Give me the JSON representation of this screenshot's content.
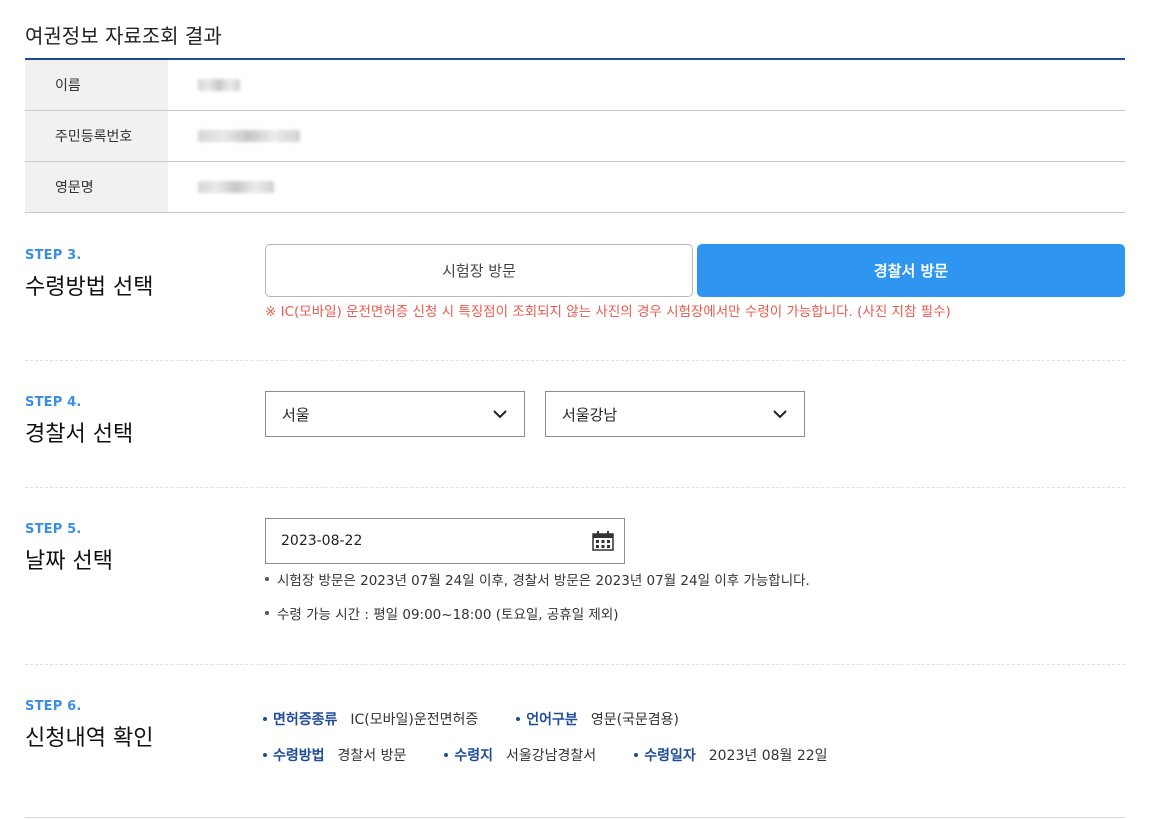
{
  "page": {
    "title": "여권정보 자료조회 결과"
  },
  "info": {
    "rows": [
      {
        "label": "이름"
      },
      {
        "label": "주민등록번호"
      },
      {
        "label": "영문명"
      }
    ]
  },
  "step3": {
    "num": "STEP 3.",
    "title": "수령방법 선택",
    "option_test_center": "시험장 방문",
    "option_police": "경찰서 방문",
    "selected": "경찰서 방문",
    "warning": "※ IC(모바일) 운전면허증 신청 시 특징점이 조회되지 않는 사진의 경우 시험장에서만 수령이 가능합니다. (사진 지참 필수)"
  },
  "step4": {
    "num": "STEP 4.",
    "title": "경찰서 선택",
    "region": "서울",
    "station": "서울강남"
  },
  "step5": {
    "num": "STEP 5.",
    "title": "날짜 선택",
    "date": "2023-08-22",
    "note1": "시험장 방문은 2023년 07월 24일 이후, 경찰서 방문은 2023년 07월 24일 이후 가능합니다.",
    "note2": "수령 가능 시간 : 평일 09:00~18:00 (토요일, 공휴일 제외)"
  },
  "step6": {
    "num": "STEP 6.",
    "title": "신청내역 확인",
    "license_type_label": "면허증종류",
    "license_type_value": "IC(모바일)운전면허증",
    "language_label": "언어구분",
    "language_value": "영문(국문겸용)",
    "method_label": "수령방법",
    "method_value": "경찰서 방문",
    "place_label": "수령지",
    "place_value": "서울강남경찰서",
    "date_label": "수령일자",
    "date_value": "2023년 08월 22일"
  },
  "colors": {
    "accent": "#2e96f0",
    "navy": "#1f4c96",
    "warning": "#e85a4f",
    "step": "#3a8ee6"
  }
}
